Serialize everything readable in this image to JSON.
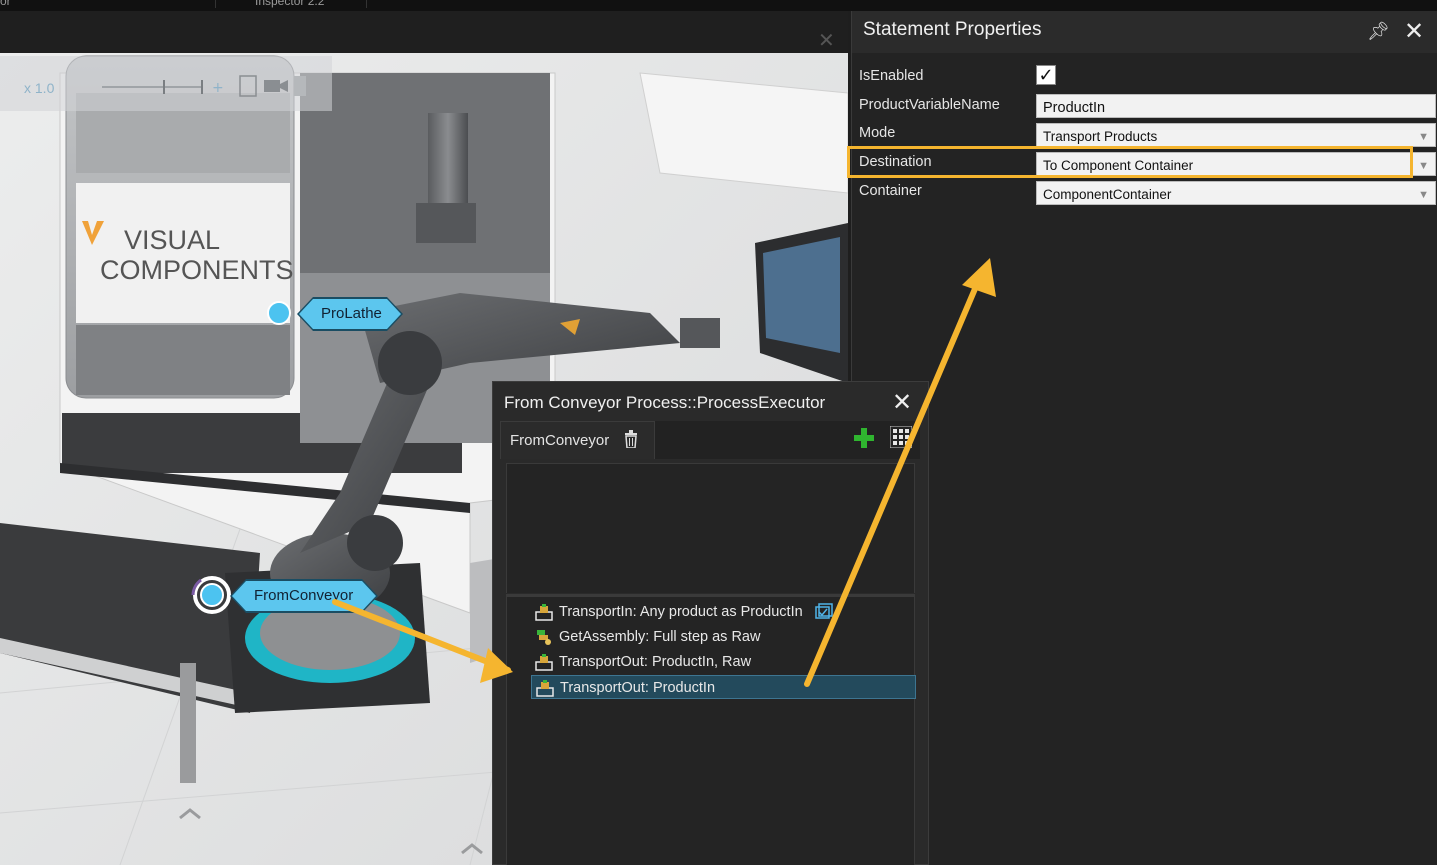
{
  "top_tabs": [
    "or",
    "Inspector 2.2"
  ],
  "viewport": {
    "zoom_label": "x 1.0",
    "close_glyph": "✕",
    "brand_line1": "VISUAL",
    "brand_line2": "COMPONENTS"
  },
  "callouts": {
    "prolathe": "ProLathe",
    "fromconveyor": "FromConveyor"
  },
  "statement_properties": {
    "title": "Statement Properties",
    "rows": [
      {
        "label": "IsEnabled",
        "value": "✓",
        "kind": "checkbox"
      },
      {
        "label": "ProductVariableName",
        "value": "ProductIn",
        "kind": "text"
      },
      {
        "label": "Mode",
        "value": "Transport Products",
        "kind": "select"
      },
      {
        "label": "Destination",
        "value": "To Component Container",
        "kind": "select"
      },
      {
        "label": "Container",
        "value": "ComponentContainer",
        "kind": "select"
      }
    ],
    "highlight_color": "#f5b52f"
  },
  "process_executor": {
    "title": "From Conveyor Process::ProcessExecutor",
    "tab_label": "FromConveyor",
    "statements": [
      {
        "label": "TransportIn: Any product as ProductIn"
      },
      {
        "label": "GetAssembly: Full step as Raw"
      },
      {
        "label": "TransportOut: ProductIn, Raw"
      },
      {
        "label": "TransportOut: ProductIn"
      }
    ]
  },
  "colors": {
    "accent_arrow": "#f5b52f",
    "callout": "#5cc6ee",
    "selected_row": "#234a5c"
  }
}
